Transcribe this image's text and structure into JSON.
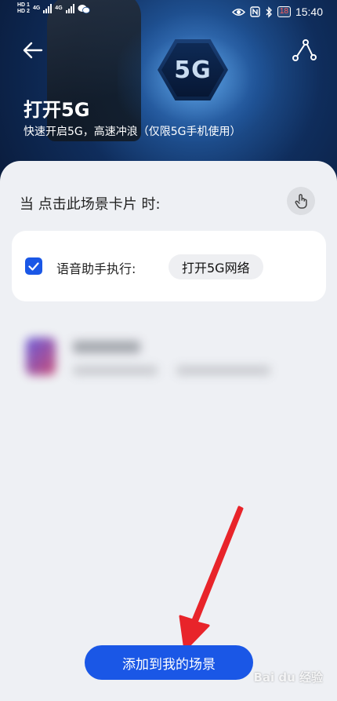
{
  "status_bar": {
    "sim1": "HD 1",
    "sim2": "HD 2",
    "net1": "4G",
    "net2": "4G",
    "battery": "18",
    "time": "15:40"
  },
  "hero": {
    "badge": "5G",
    "title": "打开5G",
    "subtitle": "快速开启5G，高速冲浪（仅限5G手机使用）"
  },
  "condition": {
    "label": "当 点击此场景卡片 时:"
  },
  "action": {
    "checked": true,
    "label": "语音助手执行:",
    "chip": "打开5G网络"
  },
  "footer": {
    "add_button": "添加到我的场景"
  },
  "colors": {
    "accent": "#1a57e6",
    "annotation_arrow": "#e8242a"
  }
}
